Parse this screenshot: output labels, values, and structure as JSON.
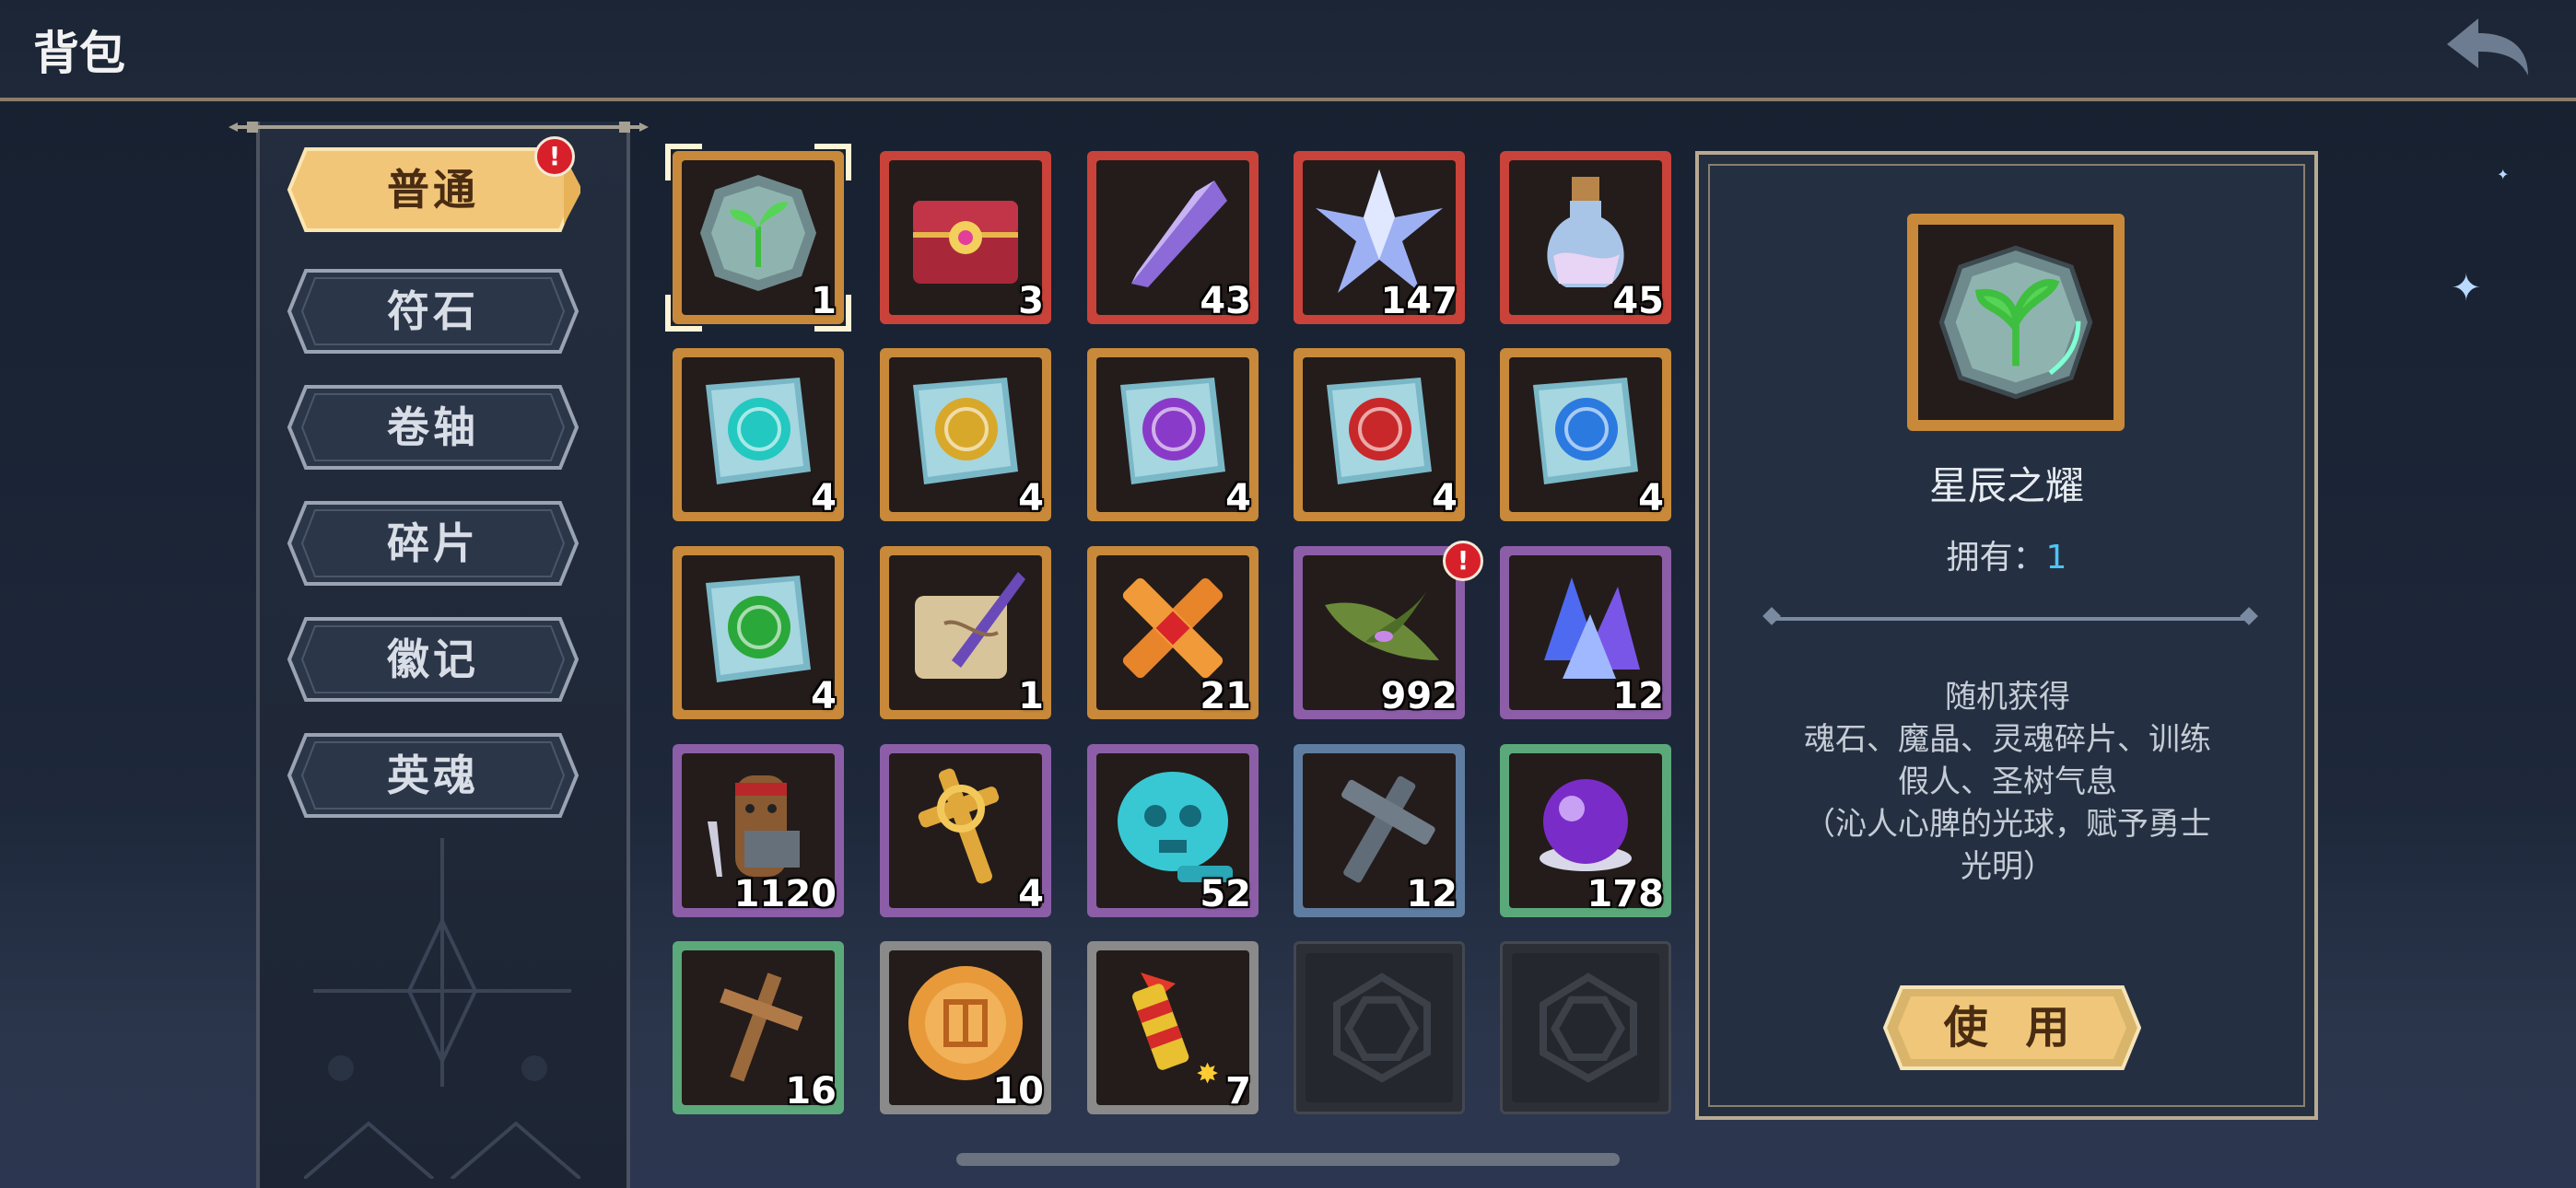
{
  "header": {
    "title": "背包"
  },
  "tabs": [
    {
      "label": "普通",
      "active": true,
      "alert": "!"
    },
    {
      "label": "符石",
      "active": false
    },
    {
      "label": "卷轴",
      "active": false
    },
    {
      "label": "碎片",
      "active": false
    },
    {
      "label": "徽记",
      "active": false
    },
    {
      "label": "英魂",
      "active": false
    }
  ],
  "items": [
    {
      "qty": "1",
      "rarity": "orange",
      "icon": "sprout-orb-icon",
      "selected": true
    },
    {
      "qty": "3",
      "rarity": "red",
      "icon": "treasure-chest-icon"
    },
    {
      "qty": "43",
      "rarity": "red",
      "icon": "purple-crystal-shard-icon"
    },
    {
      "qty": "147",
      "rarity": "red",
      "icon": "star-crystal-icon"
    },
    {
      "qty": "45",
      "rarity": "red",
      "icon": "potion-bottle-icon"
    },
    {
      "qty": "4",
      "rarity": "orange",
      "icon": "cyan-rune-scroll-icon"
    },
    {
      "qty": "4",
      "rarity": "orange",
      "icon": "yellow-rune-scroll-icon"
    },
    {
      "qty": "4",
      "rarity": "orange",
      "icon": "purple-rune-scroll-icon"
    },
    {
      "qty": "4",
      "rarity": "orange",
      "icon": "red-rune-scroll-icon"
    },
    {
      "qty": "4",
      "rarity": "orange",
      "icon": "blue-rune-scroll-icon"
    },
    {
      "qty": "4",
      "rarity": "orange",
      "icon": "green-rune-scroll-icon"
    },
    {
      "qty": "1",
      "rarity": "orange",
      "icon": "quill-scroll-icon"
    },
    {
      "qty": "21",
      "rarity": "orange",
      "icon": "gem-cross-icon"
    },
    {
      "qty": "992",
      "rarity": "purple",
      "icon": "leaf-icon",
      "alert": "!"
    },
    {
      "qty": "12",
      "rarity": "purple",
      "icon": "blue-crystal-icon"
    },
    {
      "qty": "1120",
      "rarity": "purple",
      "icon": "training-dummy-icon"
    },
    {
      "qty": "4",
      "rarity": "purple",
      "icon": "golden-cross-icon"
    },
    {
      "qty": "52",
      "rarity": "purple",
      "icon": "skull-stone-icon"
    },
    {
      "qty": "12",
      "rarity": "blue",
      "icon": "stone-cross-icon"
    },
    {
      "qty": "178",
      "rarity": "green",
      "icon": "purple-orb-icon"
    },
    {
      "qty": "16",
      "rarity": "green",
      "icon": "wooden-cross-icon"
    },
    {
      "qty": "10",
      "rarity": "gray",
      "icon": "mooncake-icon"
    },
    {
      "qty": "7",
      "rarity": "gray",
      "icon": "firework-rocket-icon"
    },
    {
      "qty": "",
      "rarity": "empty",
      "icon": "empty-slot-icon"
    },
    {
      "qty": "",
      "rarity": "empty",
      "icon": "empty-slot-icon"
    }
  ],
  "detail": {
    "name": "星辰之耀",
    "owned_label": "拥有：",
    "owned_value": "1",
    "desc_lines": [
      "随机获得",
      "魂石、魔晶、灵魂碎片、训练",
      "假人、圣树气息",
      "（沁人心脾的光球，赋予勇士",
      "光明）"
    ],
    "use_label": "使 用"
  },
  "colors": {
    "orange": "#c8893a",
    "red": "#c9433a",
    "purple": "#8c5ea8",
    "blue": "#5f7da0",
    "green": "#5ba97a",
    "gray": "#8a8a8a",
    "accent_blue": "#4fc3f7",
    "gold": "#f0c070"
  }
}
